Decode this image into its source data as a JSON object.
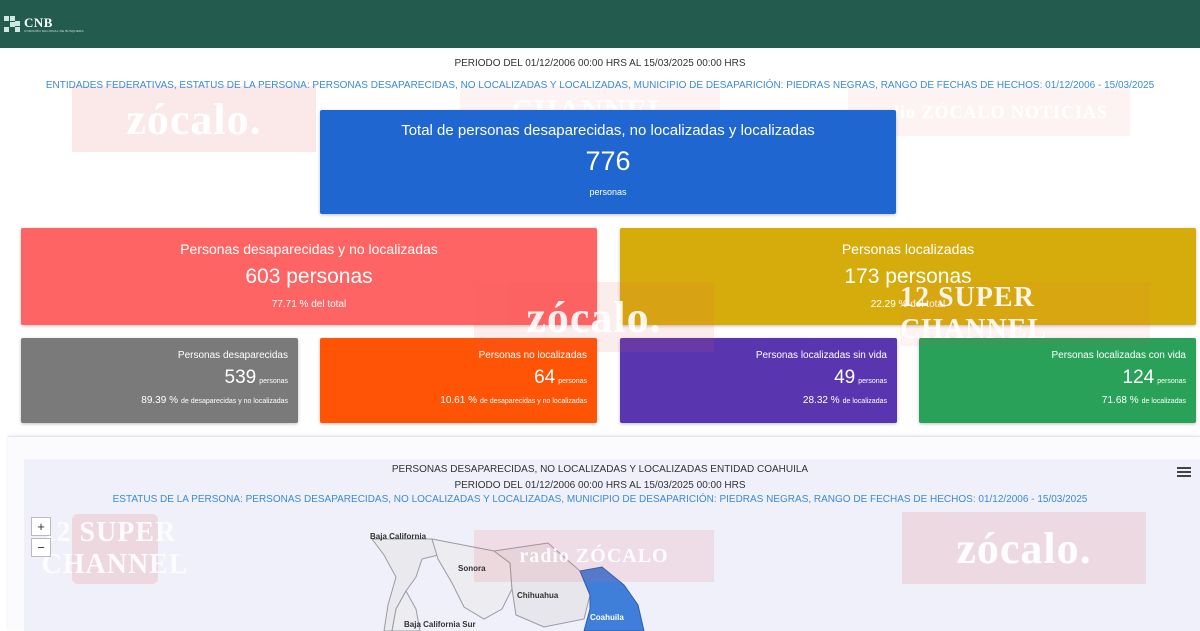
{
  "header": {
    "logo_title": "CNB",
    "logo_subtitle": "COMISIÓN NACIONAL DE BÚSQUEDA"
  },
  "summary": {
    "periodo": "PERIODO DEL 01/12/2006 00:00 HRS AL 15/03/2025 00:00 HRS",
    "filtros": "ENTIDADES FEDERATIVAS, ESTATUS DE LA PERSONA: PERSONAS DESAPARECIDAS, NO LOCALIZADAS Y LOCALIZADAS, MUNICIPIO DE DESAPARICIÓN: PIEDRAS NEGRAS, RANGO DE FECHAS DE HECHOS: 01/12/2006 - 15/03/2025"
  },
  "total_card": {
    "title": "Total de personas desaparecidas, no localizadas y localizadas",
    "value": "776",
    "unit": "personas",
    "color": "#1f66d1"
  },
  "big_cards": [
    {
      "title": "Personas desaparecidas y no localizadas",
      "value": "603 personas",
      "pct": "77.71 % del total",
      "color": "#ff6464"
    },
    {
      "title": "Personas localizadas",
      "value": "173 personas",
      "pct": "22.29 % del total",
      "color": "#d6ac0c"
    }
  ],
  "small_cards": [
    {
      "title": "Personas desaparecidas",
      "value": "539",
      "unit": "personas",
      "pct": "89.39 %",
      "pct_suffix": "de desaparecidas y no localizadas",
      "color": "#7a7a7a"
    },
    {
      "title": "Personas no localizadas",
      "value": "64",
      "unit": "personas",
      "pct": "10.61 %",
      "pct_suffix": "de desaparecidas y no localizadas",
      "color": "#ff5306"
    },
    {
      "title": "Personas localizadas sin vida",
      "value": "49",
      "unit": "personas",
      "pct": "28.32 %",
      "pct_suffix": "de localizadas",
      "color": "#5a35b0"
    },
    {
      "title": "Personas localizadas con vida",
      "value": "124",
      "unit": "personas",
      "pct": "71.68 %",
      "pct_suffix": "de localizadas",
      "color": "#2aa158"
    }
  ],
  "map": {
    "title": "PERSONAS DESAPARECIDAS, NO LOCALIZADAS Y LOCALIZADAS ENTIDAD COAHUILA",
    "periodo": "PERIODO DEL 01/12/2006 00:00 HRS AL 15/03/2025 00:00 HRS",
    "filtros": "ESTATUS DE LA PERSONA: PERSONAS DESAPARECIDAS, NO LOCALIZADAS Y LOCALIZADAS, MUNICIPIO DE DESAPARICIÓN: PIEDRAS NEGRAS, RANGO DE FECHAS DE HECHOS: 01/12/2006 - 15/03/2025",
    "zoom_in": "+",
    "zoom_out": "−",
    "states": {
      "baja_california": "Baja California",
      "sonora": "Sonora",
      "chihuahua": "Chihuahua",
      "coahuila": "Coahuila",
      "baja_california_sur": "Baja California Sur"
    },
    "highlight_color": "#3f7fd9",
    "menu_icon": "hamburger-menu-icon"
  },
  "watermarks": [
    "zócalo.",
    "CHANNEL",
    "radio ZÓCALO NOTICIAS",
    "zócalo.",
    "12 SUPER CHANNEL",
    "radio ZÓCALO",
    "zócalo."
  ]
}
